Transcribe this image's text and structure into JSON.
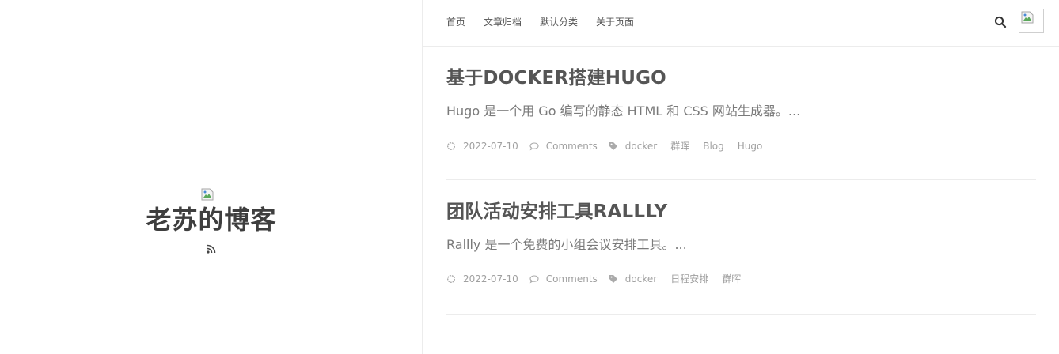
{
  "brand": {
    "title": "老苏的博客",
    "logo_icon": "broken-image-icon",
    "rss_icon": "rss-icon"
  },
  "nav": {
    "items": [
      {
        "label": "首页",
        "active": true
      },
      {
        "label": "文章归档",
        "active": false
      },
      {
        "label": "默认分类",
        "active": false
      },
      {
        "label": "关于页面",
        "active": false
      }
    ],
    "search_icon": "search-icon",
    "avatar_icon": "broken-image-icon"
  },
  "posts": [
    {
      "title": "基于DOCKER搭建HUGO",
      "excerpt": "Hugo 是一个用 Go 编写的静态 HTML 和 CSS 网站生成器。...",
      "date": "2022-07-10",
      "comments": "Comments",
      "tags": [
        "docker",
        "群晖",
        "Blog",
        "Hugo"
      ]
    },
    {
      "title": "团队活动安排工具RALLLY",
      "excerpt": "Rallly 是一个免费的小组会议安排工具。...",
      "date": "2022-07-10",
      "comments": "Comments",
      "tags": [
        "docker",
        "日程安排",
        "群晖"
      ]
    }
  ],
  "colors": {
    "text": "#555555",
    "meta": "#a0a0a0",
    "border": "#ececec",
    "title_dark": "#3e3e3e"
  }
}
